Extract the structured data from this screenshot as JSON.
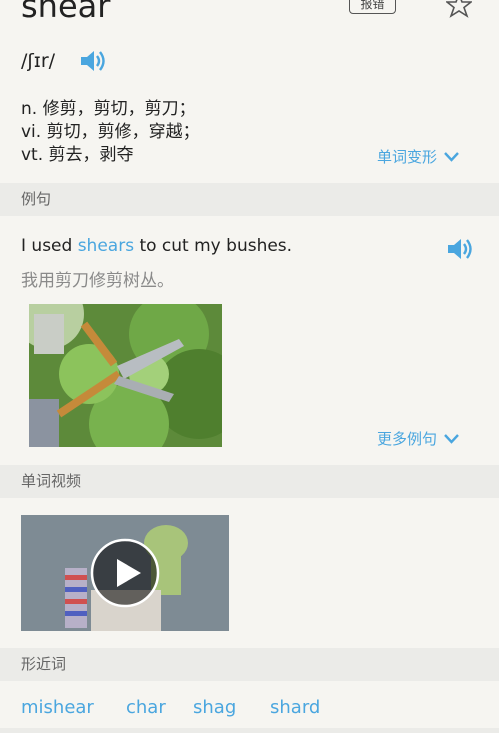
{
  "word": {
    "title": "shear",
    "report_label": "报错"
  },
  "pronunciation": {
    "phonetic": "/ʃɪr/"
  },
  "definitions": [
    {
      "pos": "n.",
      "meaning": "修剪，剪切，剪刀；"
    },
    {
      "pos": "vi.",
      "meaning": "剪切，剪修，穿越；"
    },
    {
      "pos": "vt.",
      "meaning": "剪去，剥夺"
    }
  ],
  "morph_link": "单词变形",
  "sections": {
    "examples": "例句",
    "video": "单词视频",
    "similar": "形近词"
  },
  "example": {
    "before": "I used ",
    "highlight": "shears",
    "after": " to cut my bushes.",
    "translation": "我用剪刀修剪树丛。"
  },
  "more_examples_link": "更多例句",
  "similar_words": [
    "mishear",
    "char",
    "shag",
    "shard"
  ],
  "colors": {
    "accent": "#4aa6df",
    "section_bg": "#ebebe8",
    "page_bg": "#f6f5f1"
  },
  "icons": [
    "star-icon",
    "speaker-icon",
    "chevron-down-icon",
    "play-icon"
  ]
}
